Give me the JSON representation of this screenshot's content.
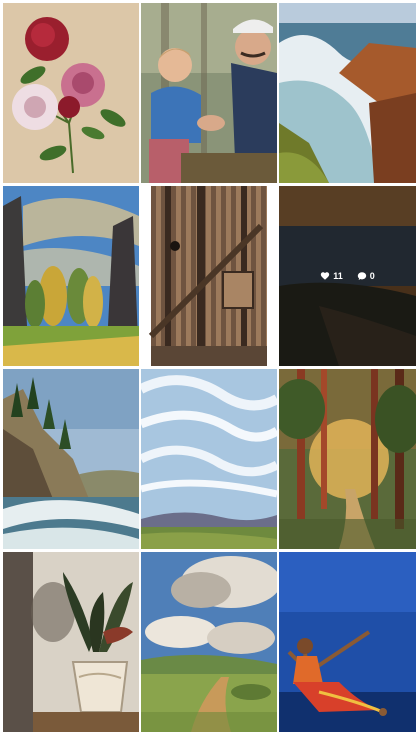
{
  "gallery": {
    "tiles": [
      {
        "name": "peony-flowers-painting"
      },
      {
        "name": "grandfather-and-child-painting"
      },
      {
        "name": "coastal-waves-rocks-painting"
      },
      {
        "name": "canyon-trees-sky-painting"
      },
      {
        "name": "old-barn-wall-photo"
      },
      {
        "name": "night-ocean-painting",
        "hovered": true,
        "likes": "11",
        "comments": "0"
      },
      {
        "name": "sea-cliff-pines-painting"
      },
      {
        "name": "cloudy-sky-valley-painting"
      },
      {
        "name": "sunlit-forest-path-painting"
      },
      {
        "name": "potted-plant-still-life"
      },
      {
        "name": "dirt-road-clouds-painting"
      },
      {
        "name": "dancer-blue-sky-painting"
      }
    ]
  },
  "icons": {
    "likes": "heart-icon",
    "comments": "comment-bubble-icon"
  },
  "colors": {
    "background": "#ffffff",
    "overlay": "rgba(0,0,0,0.55)",
    "overlay_text": "#ffffff"
  }
}
